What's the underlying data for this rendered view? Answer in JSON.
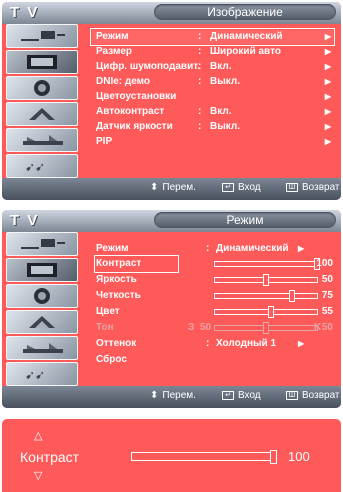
{
  "colors": {
    "panel": "#ff5a5a",
    "header": "#7c8694",
    "text": "#ffffff"
  },
  "image_menu": {
    "app_label": "T V",
    "title": "Изображение",
    "items": [
      {
        "label": "Режим",
        "value": "Динамический",
        "arrow": "▶",
        "selected": true
      },
      {
        "label": "Размер",
        "value": "Широкий авто",
        "arrow": "▶"
      },
      {
        "label": "Цифр. шумоподавит.",
        "value": "Вкл.",
        "arrow": "▶"
      },
      {
        "label": "DNIe: демо",
        "value": "Выкл.",
        "arrow": "▶"
      },
      {
        "label": "Цветоустановки",
        "value": "",
        "arrow": "▶"
      },
      {
        "label": "Автоконтраст",
        "value": "Вкл.",
        "arrow": "▶"
      },
      {
        "label": "Датчик яркости",
        "value": "Выкл.",
        "arrow": "▶"
      },
      {
        "label": "PIP",
        "value": "",
        "arrow": "▶"
      }
    ],
    "footer": {
      "move": "Перем.",
      "enter": "Вход",
      "back": "Возврат"
    }
  },
  "mode_menu": {
    "app_label": "T V",
    "title": "Режим",
    "mode": {
      "label": "Режим",
      "value": "Динамический",
      "arrow": "▶"
    },
    "sliders": [
      {
        "label": "Контраст",
        "value": 100,
        "selected": true
      },
      {
        "label": "Яркость",
        "value": 50
      },
      {
        "label": "Четкость",
        "value": 75
      },
      {
        "label": "Цвет",
        "value": 55
      }
    ],
    "tint": {
      "label": "Тон",
      "left_letter": "З",
      "left_value": "50",
      "right_letter": "K",
      "right_value": "50",
      "level": 0.5
    },
    "tone": {
      "label": "Оттенок",
      "value": "Холодный 1",
      "arrow": "▶"
    },
    "reset": {
      "label": "Сброс"
    },
    "footer": {
      "move": "Перем.",
      "enter": "Вход",
      "back": "Возврат"
    }
  },
  "adjust_bar": {
    "up": "△",
    "down": "▽",
    "label": "Контраст",
    "value": 100
  },
  "icons": [
    "input-icon",
    "picture-icon",
    "sound-icon",
    "channel-icon",
    "setup-icon",
    "guide-icon"
  ]
}
